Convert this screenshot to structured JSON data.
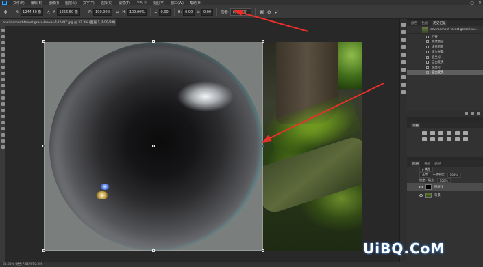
{
  "app": {
    "menu": [
      "文件(F)",
      "编辑(E)",
      "图像(I)",
      "图层(L)",
      "文字(Y)",
      "选择(S)",
      "滤镜(T)",
      "3D(D)",
      "视图(V)",
      "窗口(W)",
      "帮助(H)"
    ],
    "window_controls": [
      "—",
      "▢",
      "✕"
    ]
  },
  "options": {
    "x_label": "X:",
    "x_value": "1244.50 像",
    "y_label": "Y:",
    "y_value": "1256.50 像",
    "w_label": "W:",
    "w_value": "100.00%",
    "h_label": "H:",
    "h_value": "100.00%",
    "angle_value": "0.00",
    "hskew_label": "H:",
    "hskew_value": "0.00",
    "vskew_label": "V:",
    "vskew_value": "0.00",
    "interp_label": "插值:",
    "interp_value": "两次立方",
    "warp_icon": "warp-icon",
    "cancel_icon": "cancel-transform-icon",
    "commit_icon": "commit-checkmark-icon"
  },
  "document": {
    "tab_title": "environment-forest-grass-leaves-142497.jpg @ 33.3% (图层 1, RGB/8#) *"
  },
  "history": {
    "tabs": [
      "颜色",
      "色板",
      "历史记录"
    ],
    "active_tab": "历史记录",
    "snapshot_label": "environment-forest-grass-leav...",
    "items": [
      "打开",
      "新建图层",
      "填充前景",
      "镜头光晕",
      "极坐标",
      "自由变换",
      "极坐标",
      "自由变换"
    ],
    "active_index": 7
  },
  "adjustments": {
    "tabs": [
      "调整"
    ]
  },
  "layers": {
    "tabs": [
      "图层",
      "通道",
      "路径"
    ],
    "kind_label": "ρ 类型",
    "blend_mode": "正常",
    "opacity_label": "不透明度:",
    "opacity_value": "100%",
    "lock_label": "锁定:",
    "fill_label": "填充:",
    "fill_value": "100%",
    "items": [
      {
        "name": "图层 1"
      },
      {
        "name": "背景"
      }
    ]
  },
  "status": {
    "text": "33.33%   文档:7.66M/10.2M"
  },
  "watermark": {
    "text": "UiBQ.CoM"
  },
  "colors": {
    "accent": "#31a8ff",
    "arrow": "#e8302a"
  }
}
